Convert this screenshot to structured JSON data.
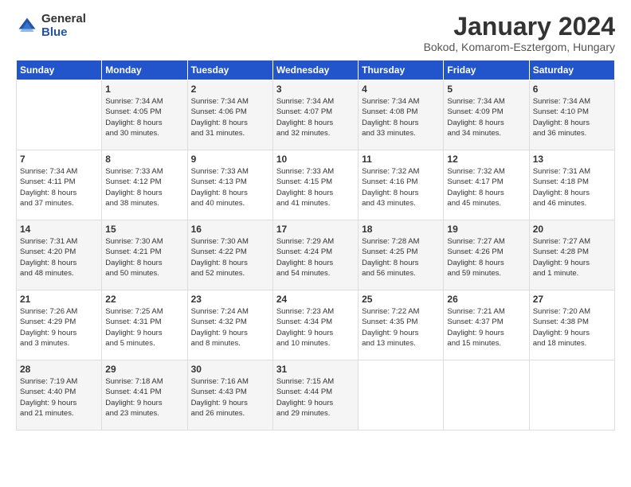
{
  "header": {
    "logo_general": "General",
    "logo_blue": "Blue",
    "title": "January 2024",
    "location": "Bokod, Komarom-Esztergom, Hungary"
  },
  "weekdays": [
    "Sunday",
    "Monday",
    "Tuesday",
    "Wednesday",
    "Thursday",
    "Friday",
    "Saturday"
  ],
  "weeks": [
    [
      {
        "day": "",
        "info": ""
      },
      {
        "day": "1",
        "info": "Sunrise: 7:34 AM\nSunset: 4:05 PM\nDaylight: 8 hours\nand 30 minutes."
      },
      {
        "day": "2",
        "info": "Sunrise: 7:34 AM\nSunset: 4:06 PM\nDaylight: 8 hours\nand 31 minutes."
      },
      {
        "day": "3",
        "info": "Sunrise: 7:34 AM\nSunset: 4:07 PM\nDaylight: 8 hours\nand 32 minutes."
      },
      {
        "day": "4",
        "info": "Sunrise: 7:34 AM\nSunset: 4:08 PM\nDaylight: 8 hours\nand 33 minutes."
      },
      {
        "day": "5",
        "info": "Sunrise: 7:34 AM\nSunset: 4:09 PM\nDaylight: 8 hours\nand 34 minutes."
      },
      {
        "day": "6",
        "info": "Sunrise: 7:34 AM\nSunset: 4:10 PM\nDaylight: 8 hours\nand 36 minutes."
      }
    ],
    [
      {
        "day": "7",
        "info": "Sunrise: 7:34 AM\nSunset: 4:11 PM\nDaylight: 8 hours\nand 37 minutes."
      },
      {
        "day": "8",
        "info": "Sunrise: 7:33 AM\nSunset: 4:12 PM\nDaylight: 8 hours\nand 38 minutes."
      },
      {
        "day": "9",
        "info": "Sunrise: 7:33 AM\nSunset: 4:13 PM\nDaylight: 8 hours\nand 40 minutes."
      },
      {
        "day": "10",
        "info": "Sunrise: 7:33 AM\nSunset: 4:15 PM\nDaylight: 8 hours\nand 41 minutes."
      },
      {
        "day": "11",
        "info": "Sunrise: 7:32 AM\nSunset: 4:16 PM\nDaylight: 8 hours\nand 43 minutes."
      },
      {
        "day": "12",
        "info": "Sunrise: 7:32 AM\nSunset: 4:17 PM\nDaylight: 8 hours\nand 45 minutes."
      },
      {
        "day": "13",
        "info": "Sunrise: 7:31 AM\nSunset: 4:18 PM\nDaylight: 8 hours\nand 46 minutes."
      }
    ],
    [
      {
        "day": "14",
        "info": "Sunrise: 7:31 AM\nSunset: 4:20 PM\nDaylight: 8 hours\nand 48 minutes."
      },
      {
        "day": "15",
        "info": "Sunrise: 7:30 AM\nSunset: 4:21 PM\nDaylight: 8 hours\nand 50 minutes."
      },
      {
        "day": "16",
        "info": "Sunrise: 7:30 AM\nSunset: 4:22 PM\nDaylight: 8 hours\nand 52 minutes."
      },
      {
        "day": "17",
        "info": "Sunrise: 7:29 AM\nSunset: 4:24 PM\nDaylight: 8 hours\nand 54 minutes."
      },
      {
        "day": "18",
        "info": "Sunrise: 7:28 AM\nSunset: 4:25 PM\nDaylight: 8 hours\nand 56 minutes."
      },
      {
        "day": "19",
        "info": "Sunrise: 7:27 AM\nSunset: 4:26 PM\nDaylight: 8 hours\nand 59 minutes."
      },
      {
        "day": "20",
        "info": "Sunrise: 7:27 AM\nSunset: 4:28 PM\nDaylight: 9 hours\nand 1 minute."
      }
    ],
    [
      {
        "day": "21",
        "info": "Sunrise: 7:26 AM\nSunset: 4:29 PM\nDaylight: 9 hours\nand 3 minutes."
      },
      {
        "day": "22",
        "info": "Sunrise: 7:25 AM\nSunset: 4:31 PM\nDaylight: 9 hours\nand 5 minutes."
      },
      {
        "day": "23",
        "info": "Sunrise: 7:24 AM\nSunset: 4:32 PM\nDaylight: 9 hours\nand 8 minutes."
      },
      {
        "day": "24",
        "info": "Sunrise: 7:23 AM\nSunset: 4:34 PM\nDaylight: 9 hours\nand 10 minutes."
      },
      {
        "day": "25",
        "info": "Sunrise: 7:22 AM\nSunset: 4:35 PM\nDaylight: 9 hours\nand 13 minutes."
      },
      {
        "day": "26",
        "info": "Sunrise: 7:21 AM\nSunset: 4:37 PM\nDaylight: 9 hours\nand 15 minutes."
      },
      {
        "day": "27",
        "info": "Sunrise: 7:20 AM\nSunset: 4:38 PM\nDaylight: 9 hours\nand 18 minutes."
      }
    ],
    [
      {
        "day": "28",
        "info": "Sunrise: 7:19 AM\nSunset: 4:40 PM\nDaylight: 9 hours\nand 21 minutes."
      },
      {
        "day": "29",
        "info": "Sunrise: 7:18 AM\nSunset: 4:41 PM\nDaylight: 9 hours\nand 23 minutes."
      },
      {
        "day": "30",
        "info": "Sunrise: 7:16 AM\nSunset: 4:43 PM\nDaylight: 9 hours\nand 26 minutes."
      },
      {
        "day": "31",
        "info": "Sunrise: 7:15 AM\nSunset: 4:44 PM\nDaylight: 9 hours\nand 29 minutes."
      },
      {
        "day": "",
        "info": ""
      },
      {
        "day": "",
        "info": ""
      },
      {
        "day": "",
        "info": ""
      }
    ]
  ]
}
